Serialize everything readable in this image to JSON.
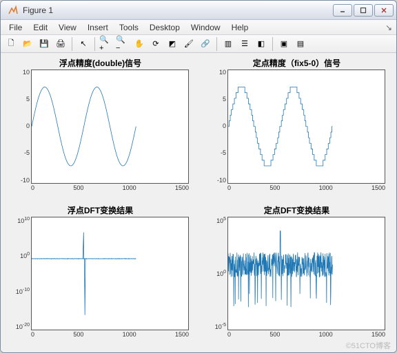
{
  "window": {
    "title": "Figure 1",
    "buttons": {
      "min": "minimize",
      "max": "maximize",
      "close": "close"
    }
  },
  "menu": {
    "items": [
      "File",
      "Edit",
      "View",
      "Insert",
      "Tools",
      "Desktop",
      "Window",
      "Help"
    ],
    "tail": "↘"
  },
  "toolbar": {
    "icons": [
      {
        "name": "new-figure-icon",
        "unicode": "🗋"
      },
      {
        "name": "open-icon",
        "unicode": "📂"
      },
      {
        "name": "save-icon",
        "unicode": "💾"
      },
      {
        "name": "print-icon",
        "unicode": "🖨"
      },
      {
        "sep": true
      },
      {
        "name": "pointer-icon",
        "unicode": "↖"
      },
      {
        "sep": true
      },
      {
        "name": "zoom-in-icon",
        "unicode": "🔍+"
      },
      {
        "name": "zoom-out-icon",
        "unicode": "🔍−"
      },
      {
        "name": "pan-icon",
        "unicode": "✋"
      },
      {
        "name": "rotate-icon",
        "unicode": "⟳"
      },
      {
        "name": "datatip-icon",
        "unicode": "◩"
      },
      {
        "name": "brush-icon",
        "unicode": "🖌"
      },
      {
        "name": "link-icon",
        "unicode": "🔗"
      },
      {
        "sep": true
      },
      {
        "name": "colorbar-icon",
        "unicode": "▥"
      },
      {
        "name": "legend-icon",
        "unicode": "☰"
      },
      {
        "name": "plottools-icon",
        "unicode": "◧"
      },
      {
        "sep": true
      },
      {
        "name": "hide-plottools-icon",
        "unicode": "▣"
      },
      {
        "name": "show-plottools-icon",
        "unicode": "▤"
      }
    ]
  },
  "watermark": "©51CTO博客",
  "chart_data": [
    {
      "type": "line",
      "title": "浮点精度(double)信号",
      "xlabel": "",
      "ylabel": "",
      "xlim": [
        0,
        1500
      ],
      "ylim": [
        -10,
        10
      ],
      "xtick": [
        0,
        500,
        1000,
        1500
      ],
      "ytick": [
        -10,
        -5,
        0,
        5,
        10
      ],
      "series": [
        {
          "name": "double-signal",
          "values_desc": "7*sin(2*pi*2*x/1000) sampled 0..1000"
        }
      ]
    },
    {
      "type": "line",
      "title": "定点精度（fix5-0）信号",
      "xlabel": "",
      "ylabel": "",
      "xlim": [
        0,
        1500
      ],
      "ylim": [
        -10,
        10
      ],
      "xtick": [
        0,
        500,
        1000,
        1500
      ],
      "ytick": [
        -10,
        -5,
        0,
        5,
        10
      ],
      "series": [
        {
          "name": "fixed-signal",
          "values_desc": "round(7*sin(2*pi*2*x/1000)) integer steps"
        }
      ]
    },
    {
      "type": "line",
      "title": "浮点DFT变换结果",
      "xlabel": "",
      "ylabel": "",
      "xlim": [
        0,
        1500
      ],
      "ylim_log10": [
        -20,
        10
      ],
      "xtick": [
        0,
        500,
        1000,
        1500
      ],
      "ytick_exp": [
        -20,
        -10,
        0,
        10
      ],
      "series": [
        {
          "name": "double-dft",
          "values_desc": "|DFT| log-scale, near-zero (~1e-1) line, central spike ~1e6 at 500 and deep notch ~1e-16 near center"
        }
      ]
    },
    {
      "type": "line",
      "title": "定点DFT变换结果",
      "xlabel": "",
      "ylabel": "",
      "xlim": [
        0,
        1500
      ],
      "ylim_log10": [
        -5,
        5
      ],
      "xtick": [
        0,
        500,
        1000,
        1500
      ],
      "ytick_exp": [
        -5,
        0,
        5
      ],
      "series": [
        {
          "name": "fixed-dft",
          "values_desc": "noisy |DFT| ~1e0..1e2 with central spike ~1e4, spans 0..1000"
        }
      ]
    }
  ]
}
